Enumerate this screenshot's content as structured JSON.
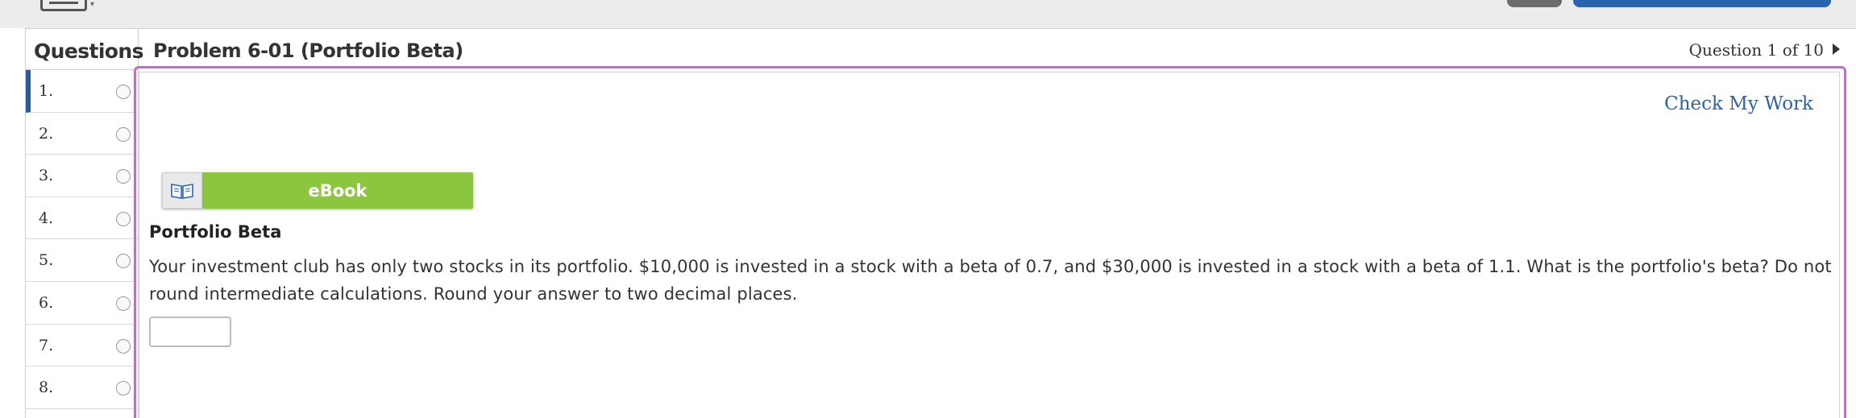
{
  "toolbar": {
    "keyboard_icon": "keyboard-icon",
    "caret_icon": "chevron-down-icon",
    "left_button_color": "#6b6b6b",
    "right_button_color": "#2a64ad"
  },
  "sidebar": {
    "title": "Questions",
    "active_color": "#2c5a99",
    "items": [
      {
        "label": "1."
      },
      {
        "label": "2."
      },
      {
        "label": "3."
      },
      {
        "label": "4."
      },
      {
        "label": "5."
      },
      {
        "label": "6."
      },
      {
        "label": "7."
      },
      {
        "label": "8."
      }
    ]
  },
  "header": {
    "problem_title": "Problem 6-01 (Portfolio Beta)",
    "question_counter": "Question 1 of 10"
  },
  "main": {
    "check_work_label": "Check My Work",
    "ebook_label": "eBook",
    "ebook_icon": "book-icon",
    "section_title": "Portfolio Beta",
    "problem_text": "Your investment club has only two stocks in its portfolio. $10,000 is invested in a stock with a beta of 0.7, and $30,000 is invested in a stock with a beta of 1.1. What is the portfolio's beta? Do not round intermediate calculations. Round your answer to two decimal places.",
    "answer_value": "",
    "frame_color": "#b07ab7",
    "ebook_color": "#8cc63f",
    "link_color": "#2b62a8"
  }
}
